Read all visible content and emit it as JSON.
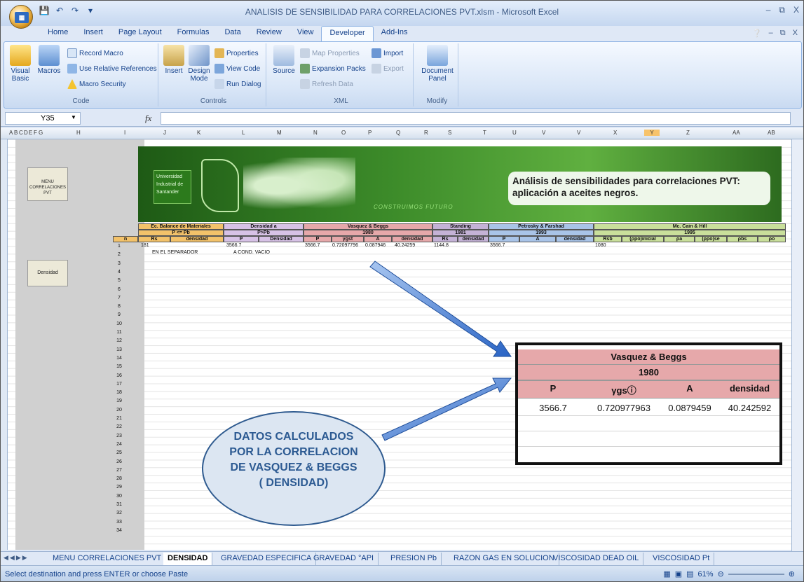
{
  "window": {
    "title": "ANALISIS DE SENSIBILIDAD PARA CORRELACIONES PVT.xlsm - Microsoft Excel",
    "minimize": "–",
    "restore": "⧉",
    "close": "X"
  },
  "ribbon_tabs": [
    "Home",
    "Insert",
    "Page Layout",
    "Formulas",
    "Data",
    "Review",
    "View",
    "Developer",
    "Add-Ins"
  ],
  "active_tab": "Developer",
  "ribbon": {
    "code": {
      "label": "Code",
      "visual_basic": "Visual Basic",
      "macros": "Macros",
      "record_macro": "Record Macro",
      "use_relative": "Use Relative References",
      "macro_security": "Macro Security"
    },
    "controls": {
      "label": "Controls",
      "insert": "Insert",
      "design_mode": "Design Mode",
      "properties": "Properties",
      "view_code": "View Code",
      "run_dialog": "Run Dialog"
    },
    "xml": {
      "label": "XML",
      "source": "Source",
      "map_properties": "Map Properties",
      "expansion_packs": "Expansion Packs",
      "refresh_data": "Refresh Data",
      "import": "Import",
      "export": "Export"
    },
    "modify": {
      "label": "Modify",
      "document_panel": "Document Panel"
    }
  },
  "formula_bar": {
    "name_box": "Y35",
    "fx": "fx",
    "value": ""
  },
  "columns": [
    "A",
    "B",
    "C",
    "D",
    "E",
    "F",
    "G",
    "H",
    "I",
    "J",
    "K",
    "L",
    "M",
    "N",
    "O",
    "P",
    "Q",
    "R",
    "S",
    "T",
    "U",
    "V",
    "V",
    "X",
    "Y",
    "Z",
    "AA",
    "AB"
  ],
  "sheet": {
    "menu_button": "MENU CORRELACIONES PVT",
    "densidad_button": "Densidad",
    "banner": {
      "university": "Universidad Industrial de Santander",
      "slogan": "CONSTRUIMOS FUTURO",
      "title": "Análisis de sensibilidades para correlaciones PVT: aplicación a aceites negros."
    },
    "groups": [
      {
        "name": "Ec. Balance de Materiales",
        "sub": "P <= Pb"
      },
      {
        "name": "Densidad a",
        "sub": "P>Pb"
      },
      {
        "name": "Vasquez & Beggs",
        "sub": "1980"
      },
      {
        "name": "Standing",
        "sub": "1981"
      },
      {
        "name": "Petrosky & Farshad",
        "sub": "1993"
      },
      {
        "name": "Mc. Cain & Hill",
        "sub": "1995"
      }
    ],
    "headers": [
      "n",
      "Rs",
      "densidad",
      "P",
      "Densidad",
      "P",
      "γgst",
      "A",
      "densidad",
      "Rs",
      "densidad",
      "P",
      "A",
      "densidad",
      "Rsb",
      "(ρpo)inicial",
      "ρa",
      "(ρpo)se",
      "ρbs",
      "ρo"
    ],
    "row1": {
      "n": "1",
      "rs": "181",
      "p_dens": "3566.7",
      "vb_p": "3566.7",
      "vb_ygst": "0.72097796",
      "vb_a": "0.087946",
      "vb_dens": "40.24259",
      "st_rs": "1144.8",
      "pf_p": "3566.7",
      "mc_rsb": "1080"
    },
    "row2_notes": {
      "n": "2",
      "separador": "EN EL SEPARADOR",
      "vacio": "A COND. VACIO"
    },
    "row_numbers": [
      "1",
      "2",
      "3",
      "4",
      "5",
      "6",
      "7",
      "8",
      "9",
      "10",
      "11",
      "12",
      "13",
      "14",
      "15",
      "16",
      "17",
      "18",
      "19",
      "20",
      "21",
      "22",
      "23",
      "24",
      "25",
      "26",
      "27",
      "28",
      "29",
      "30",
      "31",
      "32",
      "33",
      "34"
    ]
  },
  "zoom_table": {
    "title": "Vasquez & Beggs",
    "year": "1980",
    "headers": [
      "P",
      "γgsⓘ",
      "A",
      "densidad"
    ],
    "values": [
      "3566.7",
      "0.720977963",
      "0.0879459",
      "40.242592"
    ]
  },
  "callout": {
    "line1": "DATOS CALCULADOS",
    "line2": "POR LA CORRELACION",
    "line3": "DE VASQUEZ & BEGGS",
    "line4": "( DENSIDAD)"
  },
  "sheet_tabs": [
    "MENU CORRELACIONES PVT",
    "DENSIDAD",
    "GRAVEDAD ESPECIFICA",
    "GRAVEDAD °API",
    "PRESION Pb",
    "RAZON GAS EN SOLUCION",
    "VISCOSIDAD DEAD OIL",
    "VISCOSIDAD Pt"
  ],
  "active_sheet": "DENSIDAD",
  "status": {
    "message": "Select destination and press ENTER or choose Paste",
    "zoom": "61%"
  },
  "colors": {
    "accent": "#15428b",
    "banner_green": "#3d8c2a",
    "vb_header": "#e6a8aa"
  }
}
